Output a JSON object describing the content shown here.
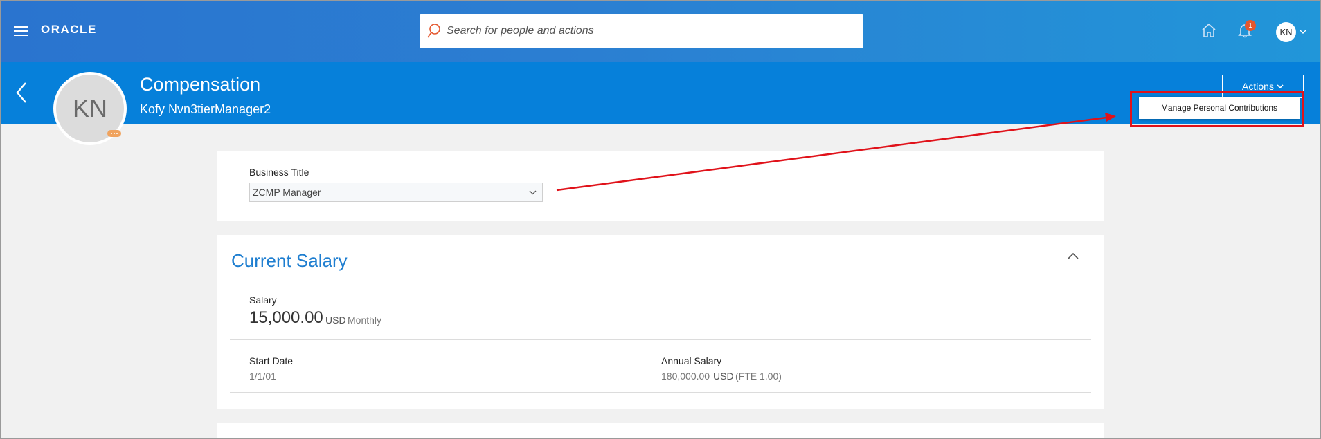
{
  "topbar": {
    "logo": "ORACLE",
    "search_placeholder": "Search for people and actions",
    "notification_count": "1",
    "user_initials": "KN"
  },
  "header": {
    "page_title": "Compensation",
    "person_name": "Kofy Nvn3tierManager2",
    "avatar_initials": "KN",
    "actions_label": "Actions",
    "dropdown_item": "Manage Personal Contributions"
  },
  "business_title": {
    "label": "Business Title",
    "value": "ZCMP Manager"
  },
  "current_salary": {
    "title": "Current Salary",
    "salary_label": "Salary",
    "salary_value": "15,000.00",
    "salary_currency": "USD",
    "salary_frequency": "Monthly",
    "start_date_label": "Start Date",
    "start_date_value": "1/1/01",
    "annual_salary_label": "Annual Salary",
    "annual_salary_value": "180,000.00",
    "annual_salary_currency": "USD",
    "annual_salary_fte": "(FTE 1.00)"
  },
  "colors": {
    "topbar": "#2a7fd2",
    "header": "#0680da",
    "accent_text": "#1e7ed0",
    "highlight": "#e0121a",
    "badge": "#e4572e"
  }
}
